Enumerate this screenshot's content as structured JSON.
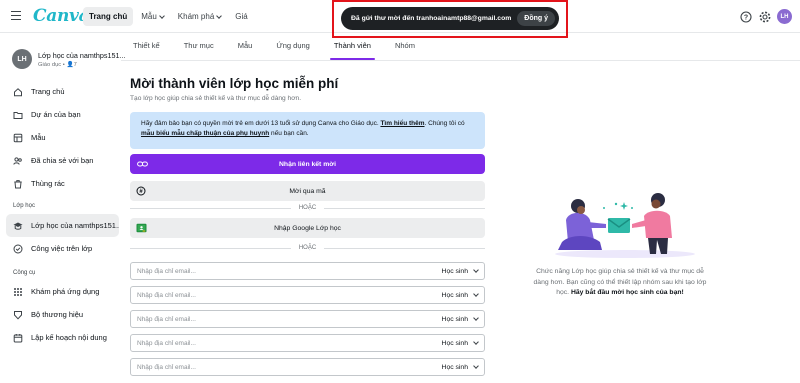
{
  "header": {
    "logo": "Canva",
    "nav": [
      {
        "label": "Trang chủ",
        "active": true,
        "dropdown": false
      },
      {
        "label": "Mẫu",
        "active": false,
        "dropdown": true
      },
      {
        "label": "Khám phá",
        "active": false,
        "dropdown": true
      },
      {
        "label": "Giá",
        "active": false,
        "dropdown": false
      }
    ],
    "icons": [
      "help-icon",
      "settings-icon"
    ],
    "avatar": "LH"
  },
  "toast": {
    "message": "Đã gửi thư mời đến tranhoainamtp88@gmail.com",
    "button": "Đồng ý",
    "highlight_color": "#e3141b"
  },
  "sidebar": {
    "team_initials": "LH",
    "team_name": "Lớp học của namthps151...",
    "team_meta": "Giáo dục • 👤7",
    "items": [
      {
        "label": "Trang chủ",
        "icon": "home-icon"
      },
      {
        "label": "Dự án của bạn",
        "icon": "folder-icon"
      },
      {
        "label": "Mẫu",
        "icon": "templates-icon"
      },
      {
        "label": "Đã chia sẻ với bạn",
        "icon": "shared-icon"
      },
      {
        "label": "Thùng rác",
        "icon": "trash-icon"
      }
    ],
    "section_class": "Lớp học",
    "class_items": [
      {
        "label": "Lớp học của namthps151...",
        "icon": "class-icon",
        "active": true
      },
      {
        "label": "Công việc trên lớp",
        "icon": "assignment-icon",
        "active": false
      }
    ],
    "section_tools": "Công cụ",
    "tool_items": [
      {
        "label": "Khám phá ứng dụng",
        "icon": "apps-icon"
      },
      {
        "label": "Bộ thương hiệu",
        "icon": "brand-icon"
      },
      {
        "label": "Lập kế hoạch nội dung",
        "icon": "calendar-icon"
      }
    ]
  },
  "tabs": [
    {
      "label": "Thiết kế",
      "active": false
    },
    {
      "label": "Thư mục",
      "active": false
    },
    {
      "label": "Mẫu",
      "active": false
    },
    {
      "label": "Ứng dụng",
      "active": false
    },
    {
      "label": "Thành viên",
      "active": true
    },
    {
      "label": "Nhóm",
      "active": false
    }
  ],
  "main": {
    "title": "Mời thành viên lớp học miễn phí",
    "subtitle": "Tạo lớp học giúp chia sẻ thiết kế và thư mục dễ dàng hơn.",
    "info_text_1": "Hãy đảm bảo bạn có quyền mời trẻ em dưới 13 tuổi sử dụng Canva cho Giáo dục. ",
    "info_link_1": "Tìm hiểu thêm",
    "info_text_2": ". Chúng tôi có ",
    "info_link_2": "mẫu biểu mẫu chấp thuận của phụ huynh",
    "info_text_3": " nếu bạn cần.",
    "invite_link_button": "Nhận liên kết mời",
    "invite_code_button": "Mời qua mã",
    "or_label": "HOẶC",
    "google_button": "Nhập Google Lớp học",
    "email_placeholder": "Nhập địa chỉ email...",
    "role_label": "Học sinh",
    "email_rows": 5
  },
  "illustration": {
    "text_1": "Chức năng Lớp học giúp chia sẻ thiết kế và thư mục dễ dàng hơn. Bạn cũng có thể thiết lập nhóm sau khi tạo lớp học. ",
    "text_bold": "Hãy bắt đầu mời học sinh của bạn!",
    "colors": {
      "person_left": "#7c62d8",
      "person_right": "#f07aa0",
      "envelope": "#2fb9a8",
      "accent": "#7d2ae8"
    }
  }
}
